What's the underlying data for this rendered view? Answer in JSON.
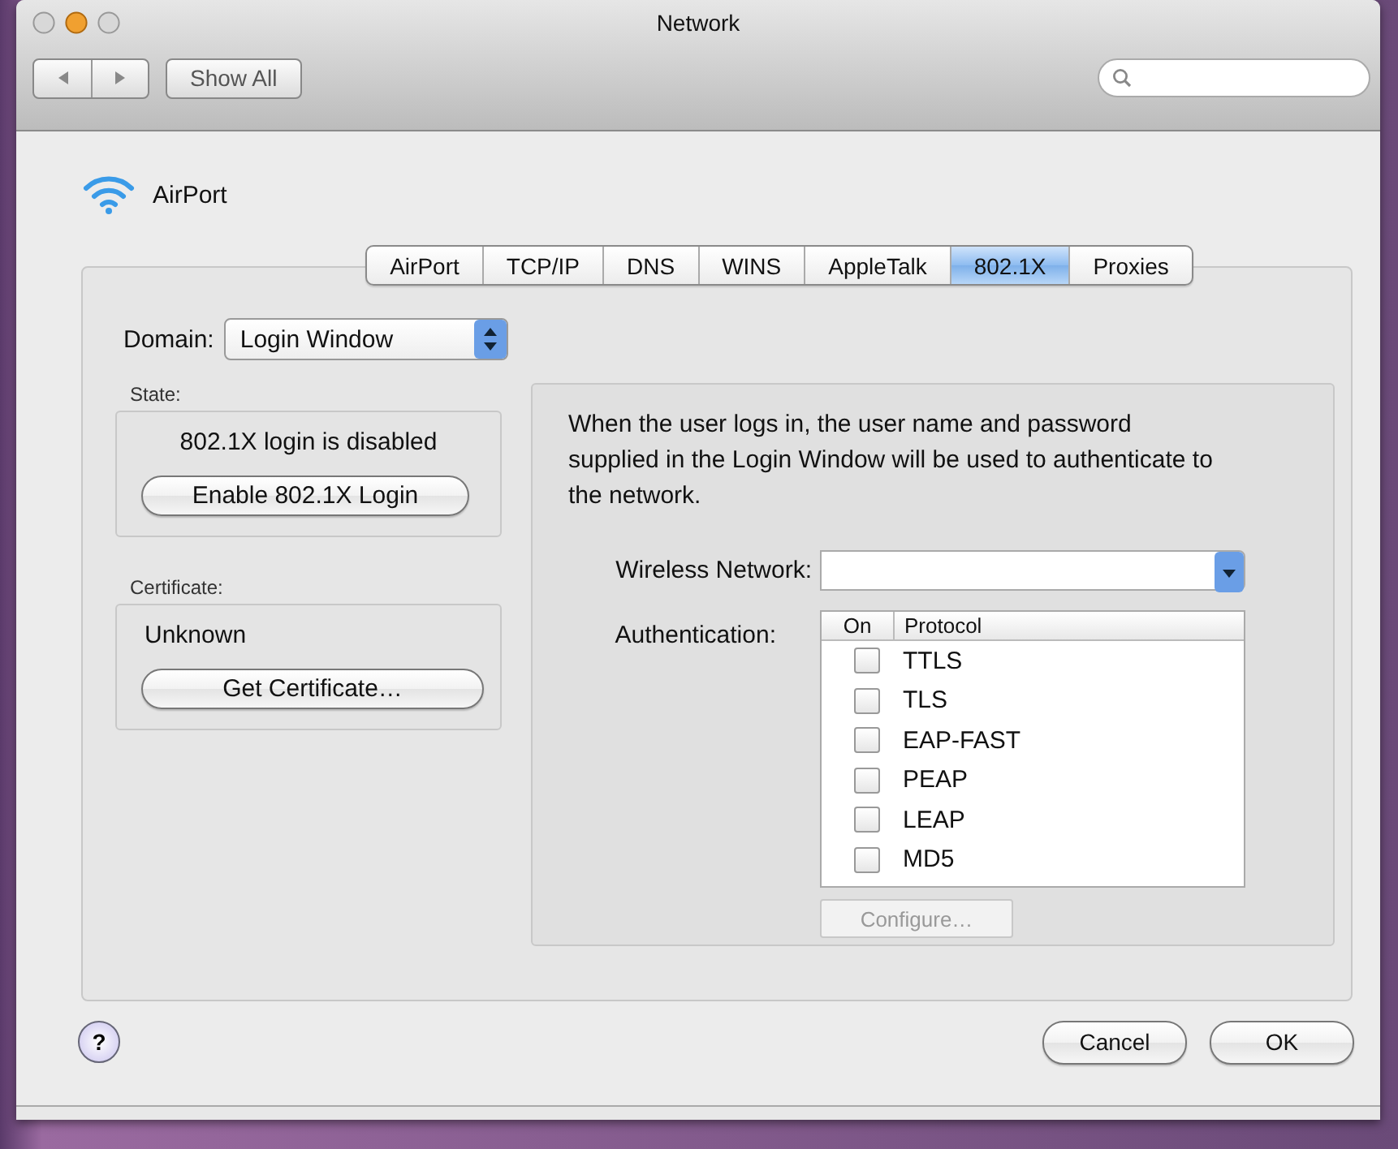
{
  "window": {
    "title": "Network"
  },
  "toolbar": {
    "show_all": "Show All"
  },
  "service": {
    "name": "AirPort"
  },
  "tabs": [
    {
      "label": "AirPort",
      "selected": false
    },
    {
      "label": "TCP/IP",
      "selected": false
    },
    {
      "label": "DNS",
      "selected": false
    },
    {
      "label": "WINS",
      "selected": false
    },
    {
      "label": "AppleTalk",
      "selected": false
    },
    {
      "label": "802.1X",
      "selected": true
    },
    {
      "label": "Proxies",
      "selected": false
    }
  ],
  "domain": {
    "label": "Domain:",
    "value": "Login Window"
  },
  "state": {
    "label": "State:",
    "text": "802.1X login is disabled",
    "button": "Enable 802.1X Login"
  },
  "certificate": {
    "label": "Certificate:",
    "text": "Unknown",
    "button": "Get Certificate…"
  },
  "description": "When the user logs in, the user name and password supplied in the Login Window will be used to authenticate to the network.",
  "wireless_network": {
    "label": "Wireless Network:"
  },
  "authentication": {
    "label": "Authentication:",
    "columns": [
      "On",
      "Protocol"
    ],
    "protocols": [
      {
        "name": "TTLS",
        "on": false
      },
      {
        "name": "TLS",
        "on": false
      },
      {
        "name": "EAP-FAST",
        "on": false
      },
      {
        "name": "PEAP",
        "on": false
      },
      {
        "name": "LEAP",
        "on": false
      },
      {
        "name": "MD5",
        "on": false
      }
    ]
  },
  "configure_button": {
    "label": "Configure…",
    "disabled": true
  },
  "help_button": "?",
  "footer_buttons": [
    "Cancel",
    "OK"
  ]
}
